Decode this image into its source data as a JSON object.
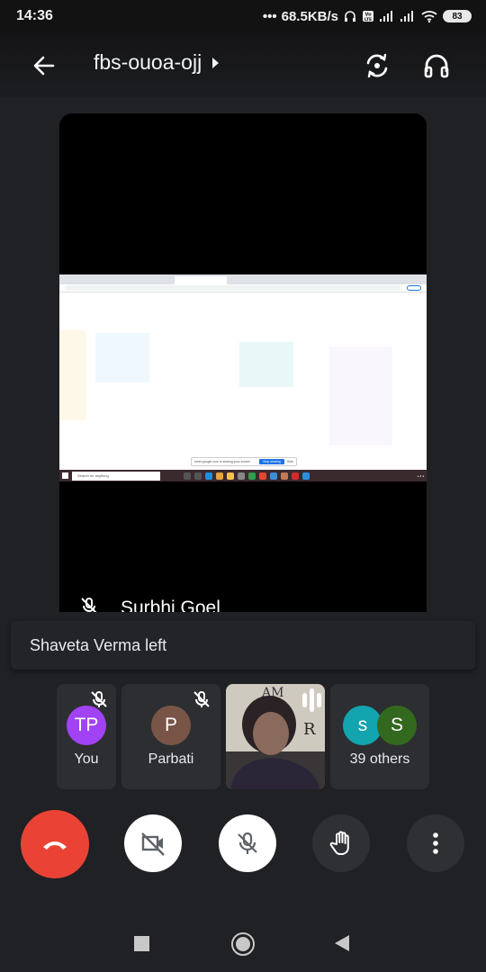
{
  "status_bar": {
    "time": "14:36",
    "network_speed": "68.5KB/s",
    "battery": "83",
    "icons": [
      "headset-icon",
      "volte-icon",
      "signal-icon",
      "signal-icon",
      "wifi-icon",
      "battery-icon"
    ]
  },
  "header": {
    "meeting_code": "fbs-ouoa-ojj",
    "back_icon": "arrow-left-icon",
    "expand_icon": "caret-right-icon",
    "flip_camera_icon": "flip-camera-icon",
    "audio_icon": "headphones-icon"
  },
  "main_video": {
    "speaker_name": "Surbhi Goel",
    "muted": true,
    "shared_screen": {
      "taskbar_search": "Search for anything",
      "share_notice": "meet.google.com is sharing your screen",
      "stop_sharing": "Stop sharing",
      "hide": "Hide"
    }
  },
  "notification": {
    "text": "Shaveta Verma left"
  },
  "participants": [
    {
      "label": "You",
      "initials": "TP",
      "avatar_color": "#a142f4",
      "muted": true
    },
    {
      "label": "Parbati",
      "initials": "P",
      "avatar_color": "#795548",
      "muted": true
    },
    {
      "label": "",
      "video": true,
      "speaking": true
    },
    {
      "label": "39 others",
      "avatars": [
        {
          "initials": "s",
          "color": "#12a4af"
        },
        {
          "initials": "S",
          "color": "#33691e"
        }
      ]
    }
  ],
  "controls": {
    "end_call": "end-call-icon",
    "camera": "camera-off-icon",
    "mic": "mic-off-icon",
    "raise_hand": "raise-hand-icon",
    "more": "more-vert-icon",
    "colors": {
      "end_call": "#ea4335",
      "active_bg": "#ffffff",
      "inactive_bg": "#2f3034"
    }
  },
  "nav_bar": {
    "recents": "recents-icon",
    "home": "home-icon",
    "back": "back-icon"
  }
}
